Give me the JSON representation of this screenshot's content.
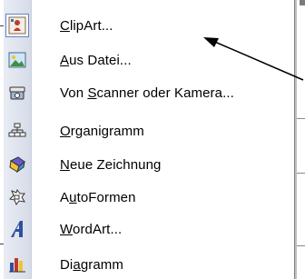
{
  "menu": {
    "items": [
      {
        "pre": "",
        "acc": "C",
        "post": "lipArt...",
        "icon": "clipart-icon",
        "selected": true
      },
      {
        "pre": "",
        "acc": "A",
        "post": "us Datei...",
        "icon": "picture-from-file-icon",
        "selected": false
      },
      {
        "pre": "Von ",
        "acc": "S",
        "post": "canner oder Kamera...",
        "icon": "scanner-camera-icon",
        "selected": false
      },
      {
        "pre": "",
        "acc": "O",
        "post": "rganigramm",
        "icon": "org-chart-icon",
        "selected": false
      },
      {
        "pre": "",
        "acc": "N",
        "post": "eue Zeichnung",
        "icon": "new-drawing-icon",
        "selected": false
      },
      {
        "pre": "A",
        "acc": "u",
        "post": "toFormen",
        "icon": "autoshapes-icon",
        "selected": false
      },
      {
        "pre": "",
        "acc": "W",
        "post": "ordArt...",
        "icon": "wordart-icon",
        "selected": false
      },
      {
        "pre": "Di",
        "acc": "a",
        "post": "gramm",
        "icon": "chart-icon",
        "selected": false
      }
    ]
  },
  "colors": {
    "gutter": "#dfe4ee",
    "selection_border": "#6a7fbf",
    "arrow": "#000000"
  }
}
